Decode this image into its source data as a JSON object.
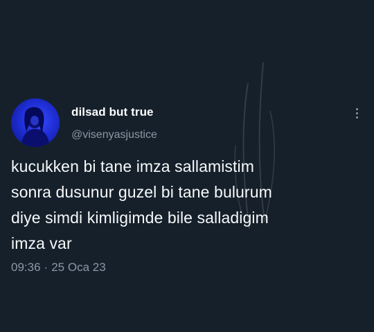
{
  "tweet": {
    "display_name": "dilsad but true",
    "username": "@visenyasjustice",
    "text": "kucukken bi tane imza sallamistim\nsonra dusunur guzel bi tane bulurum\ndiye simdi kimligimde bile salladigim\nimza var",
    "time": "09:36",
    "separator": "·",
    "date": "25 Oca 23"
  },
  "icons": {
    "avatar": "avatar-photo",
    "more": "more-vertical-icon"
  },
  "colors": {
    "background": "#15202b",
    "text": "#f7f9f9",
    "secondary": "#8b98a5",
    "avatar_tint": "#1f2fd6"
  }
}
